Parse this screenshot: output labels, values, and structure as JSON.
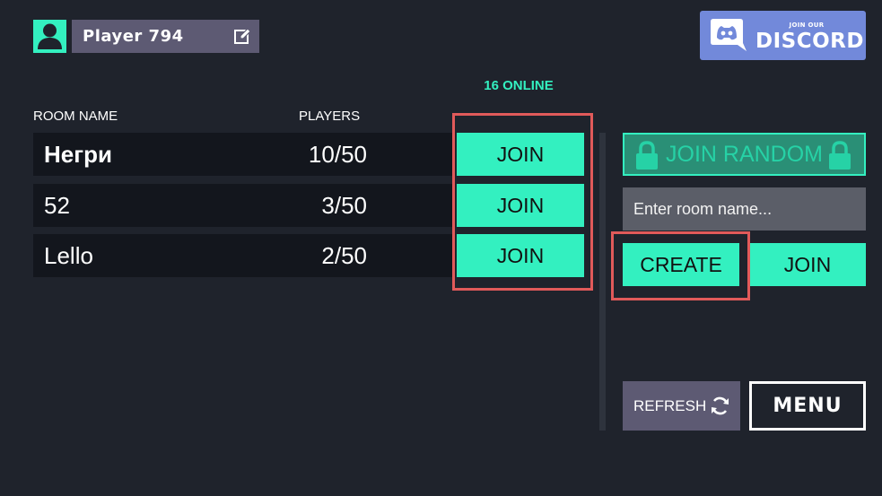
{
  "header": {
    "player_name": "Player 794",
    "discord_small": "JOIN OUR",
    "discord_big": "DISCORD"
  },
  "online_count": "16 ONLINE",
  "room_list": {
    "columns": {
      "room_name": "ROOM NAME",
      "players": "PLAYERS"
    },
    "rows": [
      {
        "name": "Негри",
        "players": "10/50",
        "join_label": "JOIN"
      },
      {
        "name": "52",
        "players": "3/50",
        "join_label": "JOIN"
      },
      {
        "name": "Lello",
        "players": "2/50",
        "join_label": "JOIN"
      }
    ]
  },
  "side_panel": {
    "join_random_label": "JOIN RANDOM",
    "room_input_placeholder": "Enter room name...",
    "create_label": "CREATE",
    "join_label": "JOIN",
    "refresh_label": "REFRESH",
    "menu_label": "MENU"
  },
  "colors": {
    "background": "#1f232c",
    "accent": "#33f0c0",
    "row_background": "#13161d",
    "name_box": "#5d5a73",
    "discord": "#7289da",
    "highlight": "#e15a5a"
  },
  "icons": {
    "avatar": "user-icon",
    "edit": "edit-icon",
    "discord": "discord-logo-icon",
    "lock": "lock-icon",
    "refresh": "refresh-icon"
  }
}
